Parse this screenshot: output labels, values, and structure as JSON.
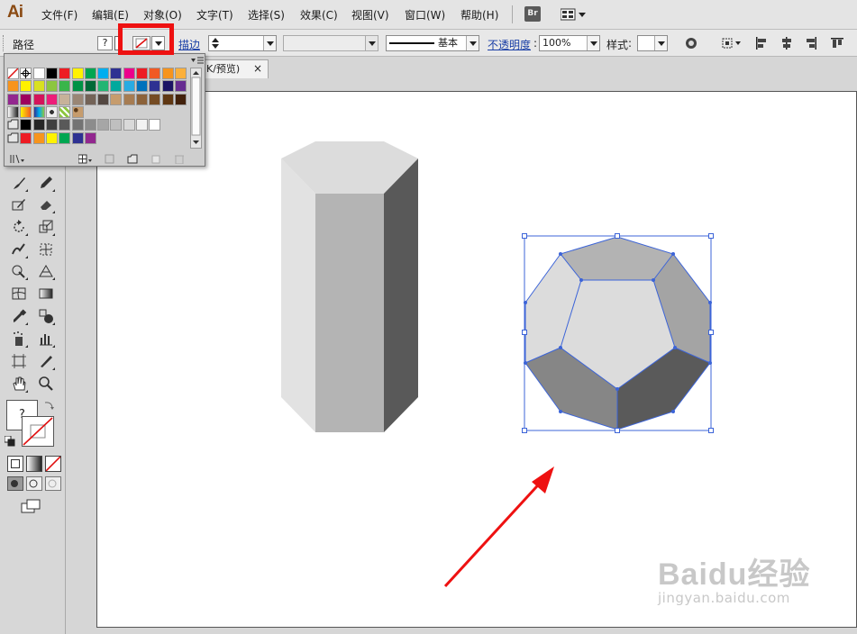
{
  "app": {
    "logo": "Ai",
    "brand_color": "#8a4a12"
  },
  "menu": {
    "items": [
      "文件(F)",
      "编辑(E)",
      "对象(O)",
      "文字(T)",
      "选择(S)",
      "效果(C)",
      "视图(V)",
      "窗口(W)",
      "帮助(H)"
    ],
    "bridge_button": "Br"
  },
  "control_bar": {
    "object_type": "路径",
    "fill_unknown": "?",
    "stroke_label": "描边",
    "stroke_style_label": "基本",
    "opacity_label": "不透明度",
    "opacity_value": "100%",
    "style_label": "样式",
    "highlight_color": "#ee1111"
  },
  "document": {
    "tab_label": "K/预览)",
    "close_glyph": "×"
  },
  "tools": {
    "fill_unknown": "?"
  },
  "swatches": {
    "row1": [
      "#ffffff",
      "#000000",
      "#ed1c24",
      "#fff200",
      "#00a651",
      "#00aeef",
      "#2e3192",
      "#ec008c",
      "#ed1c24",
      "#f15a24",
      "#f7941d",
      "#fbb03b"
    ],
    "row2": [
      "#f7941d",
      "#fff200",
      "#d9e021",
      "#8cc63f",
      "#39b54a",
      "#009245",
      "#006837",
      "#22b573",
      "#00a99d",
      "#29abe2",
      "#0071bc",
      "#2e3192",
      "#1b1464",
      "#662d91"
    ],
    "row3": [
      "#93278f",
      "#9e005d",
      "#d4145a",
      "#ed1e79",
      "#c7b299",
      "#998675",
      "#736357",
      "#534741",
      "#c69c6d",
      "#a67c52",
      "#8c6239",
      "#754c24",
      "#603813",
      "#42210b"
    ],
    "row4_patterns": [
      "gradient-white-black",
      "gradient-orange",
      "gradient-rainbow",
      "pattern-dots",
      "pattern-green",
      "pattern-leopard"
    ],
    "row5_grays": [
      "#000000",
      "#262626",
      "#404040",
      "#595959",
      "#737373",
      "#8c8c8c",
      "#a6a6a6",
      "#bfbfbf",
      "#d9d9d9",
      "#f2f2f2",
      "#ffffff"
    ],
    "row6_group": [
      "#ed1c24",
      "#f7941d",
      "#fff200",
      "#00a651",
      "#2e3192",
      "#92278f"
    ]
  },
  "icons": {
    "fill_none": "none-swatch-icon",
    "registration": "registration-icon",
    "folder": "folder-icon"
  },
  "watermark": {
    "logo": "Baidu经验",
    "url": "jingyan.baidu.com"
  },
  "colors": {
    "selection": "#3c64d8",
    "arrow": "#ee1111",
    "artboard": "#ffffff",
    "canvas_bg": "#d6d6d6"
  }
}
